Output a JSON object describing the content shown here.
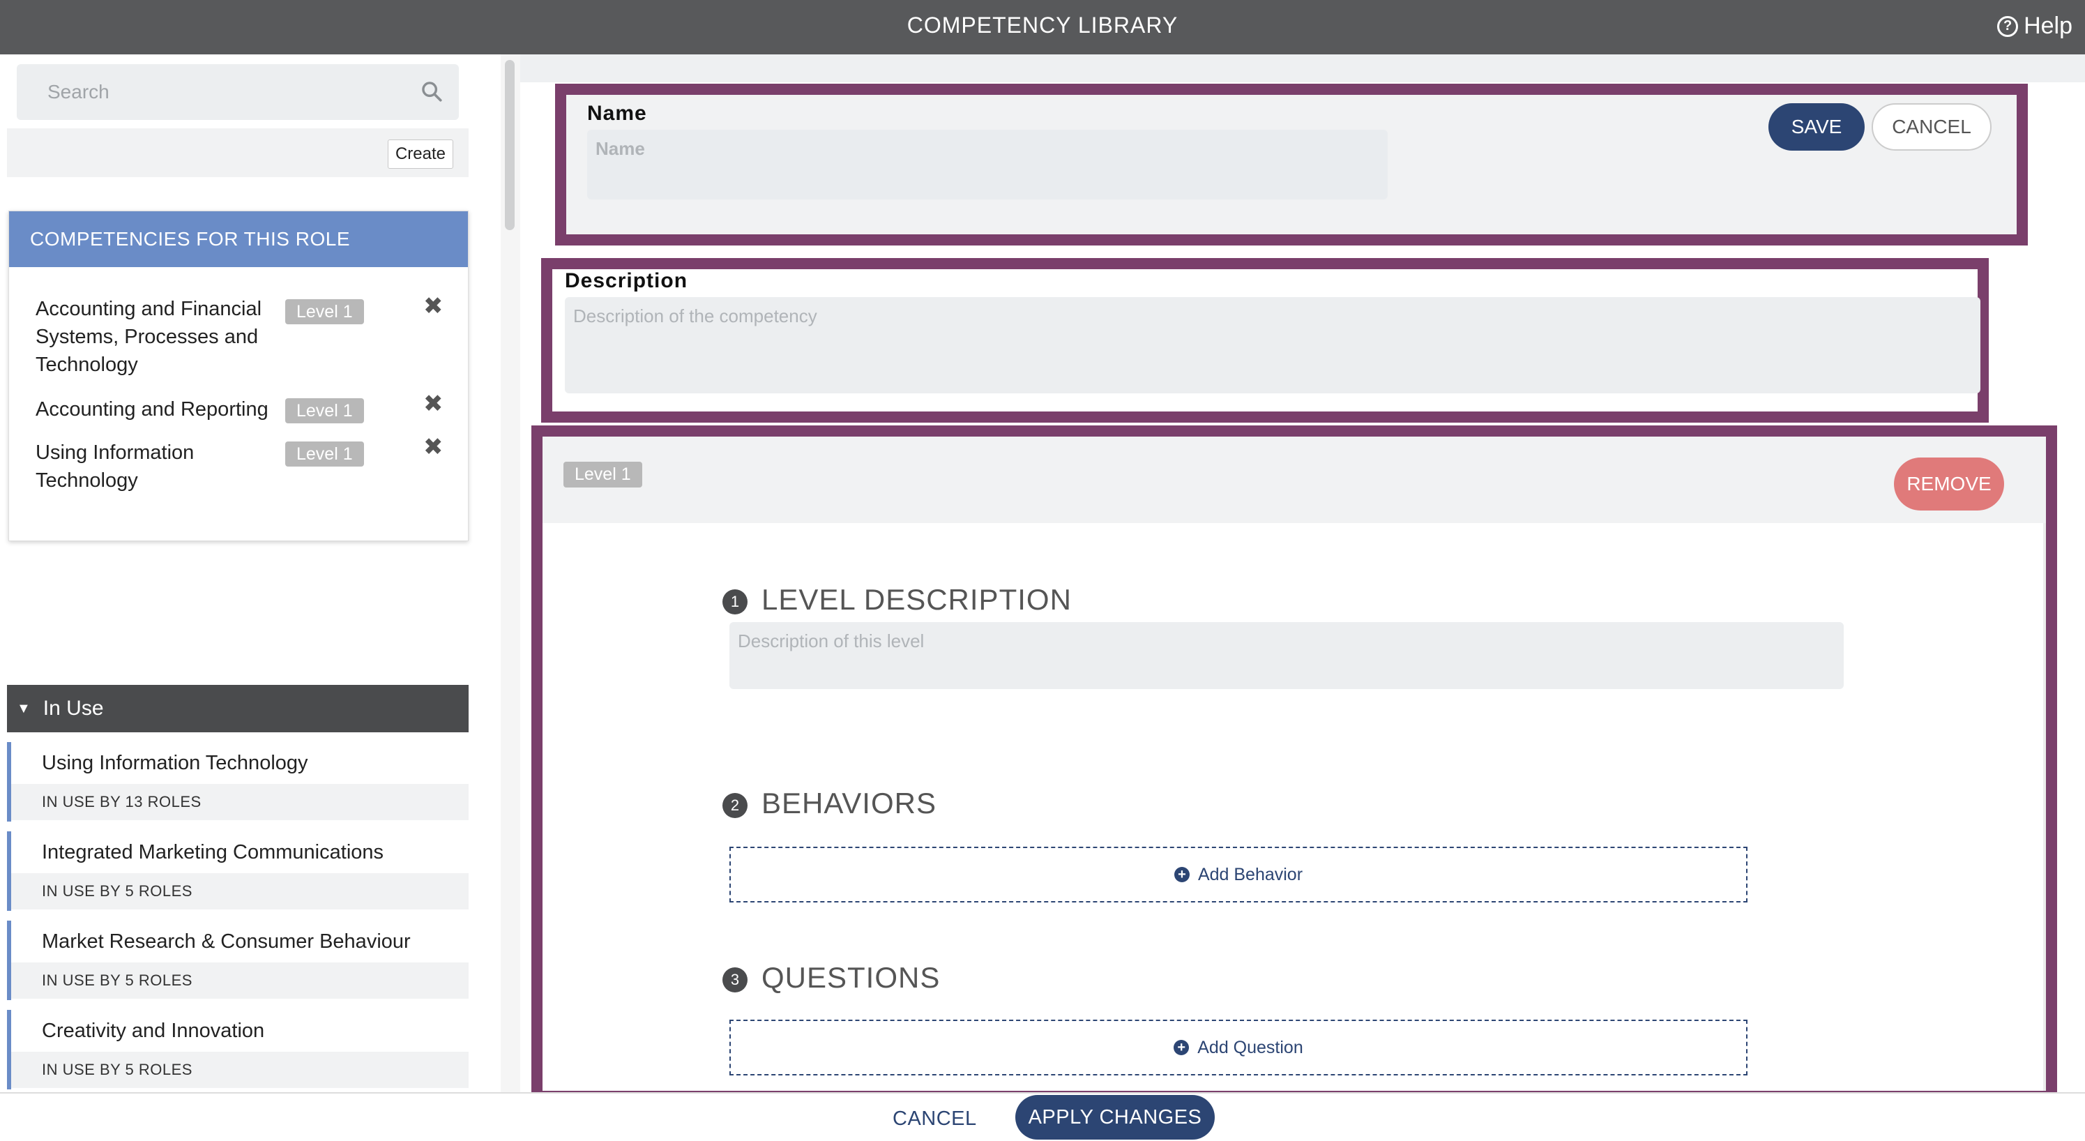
{
  "header": {
    "title": "COMPETENCY LIBRARY",
    "help_label": "Help"
  },
  "sidebar": {
    "search_placeholder": "Search",
    "create_label": "Create",
    "role_card": {
      "title": "COMPETENCIES FOR THIS ROLE",
      "items": [
        {
          "name": "Accounting and Financial Systems, Processes and Technology",
          "level": "Level 1"
        },
        {
          "name": "Accounting and Reporting",
          "level": "Level 1"
        },
        {
          "name": "Using Information Technology",
          "level": "Level 1"
        }
      ]
    },
    "in_use": {
      "header": "In Use",
      "items": [
        {
          "name": "Using Information Technology",
          "count": "IN USE BY 13 ROLES"
        },
        {
          "name": "Integrated Marketing Communications",
          "count": "IN USE BY 5 ROLES"
        },
        {
          "name": "Market Research & Consumer Behaviour",
          "count": "IN USE BY 5 ROLES"
        },
        {
          "name": "Creativity and Innovation",
          "count": "IN USE BY 5 ROLES"
        }
      ]
    }
  },
  "form": {
    "name_label": "Name",
    "name_placeholder": "Name",
    "save_label": "SAVE",
    "cancel_label": "CANCEL",
    "description_label": "Description",
    "description_placeholder": "Description of the competency",
    "level": {
      "badge": "Level 1",
      "remove_label": "REMOVE",
      "steps": [
        {
          "num": "1",
          "title": "LEVEL DESCRIPTION"
        },
        {
          "num": "2",
          "title": "BEHAVIORS"
        },
        {
          "num": "3",
          "title": "QUESTIONS"
        }
      ],
      "level_description_placeholder": "Description of this level",
      "add_behavior_label": "Add Behavior",
      "add_question_label": "Add Question"
    }
  },
  "footer": {
    "cancel_label": "CANCEL",
    "apply_label": "APPLY CHANGES"
  },
  "colors": {
    "header_bg": "#58595b",
    "accent_blue": "#6a8cc7",
    "navy": "#2c4573",
    "highlight_border": "#7a3f6b",
    "remove_red": "#e07a7a"
  }
}
